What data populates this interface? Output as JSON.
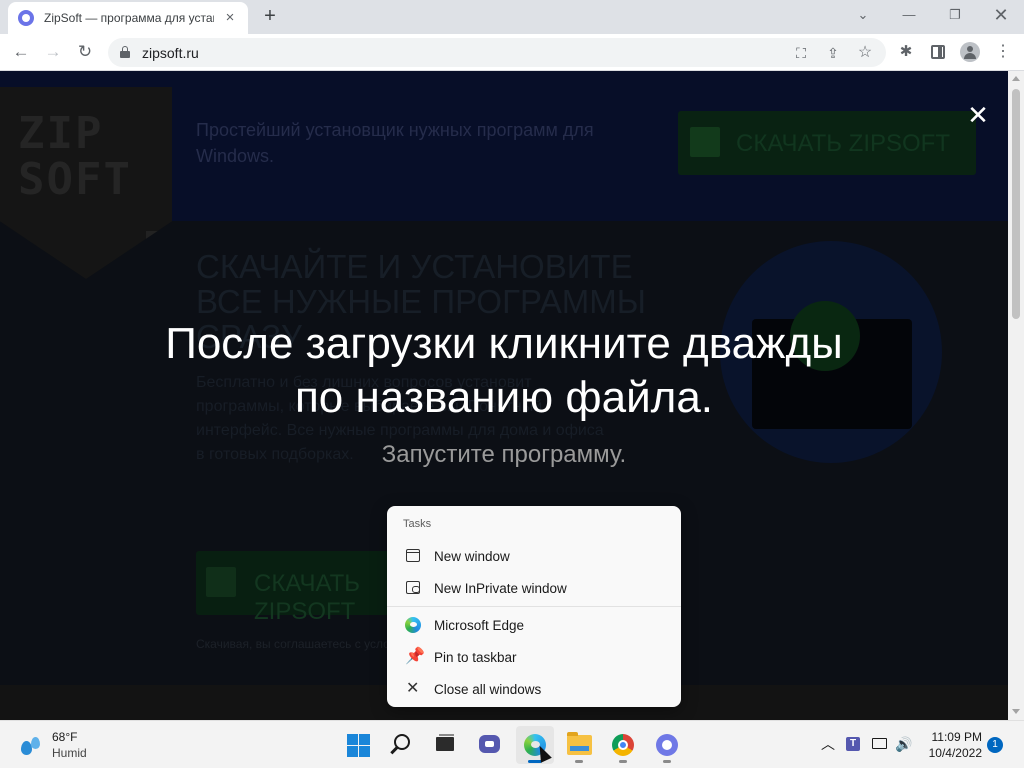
{
  "browser": {
    "tab": {
      "title": "ZipSoft — программа для установки",
      "close_glyph": "×"
    },
    "new_tab_glyph": "+",
    "window_controls": {
      "tab_search": "⌄",
      "minimize": "—",
      "maximize": "❐",
      "close": "✕"
    },
    "nav": {
      "back": "←",
      "forward": "→",
      "reload": "↻"
    },
    "url": "zipsoft.ru",
    "omnibox_icons": {
      "translate": "⛶",
      "share": "⇪",
      "bookmark": "☆"
    },
    "toolbar_icons": {
      "extensions": "✱",
      "menu": "⋮"
    }
  },
  "page": {
    "logo": "ZIP\nSOFT",
    "header_tagline": "Простейший установщик нужных программ для Windows.",
    "header_cta": "СКАЧАТЬ ZIPSOFT",
    "hero_title": "СКАЧАЙТЕ И УСТАНОВИТЕ ВСЕ НУЖНЫЕ ПРОГРАММЫ СРАЗУ",
    "hero_text": "Бесплатно и без лишних вопросов установит программы, которые выбираете вы. Понятный интерфейс. Все нужные программы для дома и офиса в готовых подборках.",
    "hero_cta": "СКАЧАТЬ ZIPSOFT",
    "hero_note": "Скачивая, вы соглашаетесь с условиями лицензии",
    "overlay": {
      "close_glyph": "✕",
      "headline": "После загрузки кликните дважды по названию файла.",
      "subline": "Запустите программу."
    }
  },
  "jumplist": {
    "heading": "Tasks",
    "items": [
      {
        "label": "New window",
        "icon": "window-icon"
      },
      {
        "label": "New InPrivate window",
        "icon": "inprivate-window-icon"
      },
      {
        "label": "Microsoft Edge",
        "icon": "edge-icon"
      },
      {
        "label": "Pin to taskbar",
        "icon": "pin-icon"
      },
      {
        "label": "Close all windows",
        "icon": "close-icon"
      }
    ],
    "pin_glyph": "📌",
    "close_glyph": "✕"
  },
  "taskbar": {
    "weather": {
      "temp": "68°F",
      "condition": "Humid"
    },
    "apps": [
      "start",
      "search",
      "task-view",
      "teams-chat",
      "microsoft-edge",
      "file-explorer",
      "google-chrome",
      "zipsoft"
    ],
    "tray": {
      "chevron": "︿",
      "volume": "🔊"
    },
    "clock": {
      "time": "11:09 PM",
      "date": "10/4/2022"
    },
    "notifications": "1"
  },
  "colors": {
    "accent": "#0067c0",
    "overlay_text": "#ffffff",
    "subline": "#9a9a9a"
  }
}
